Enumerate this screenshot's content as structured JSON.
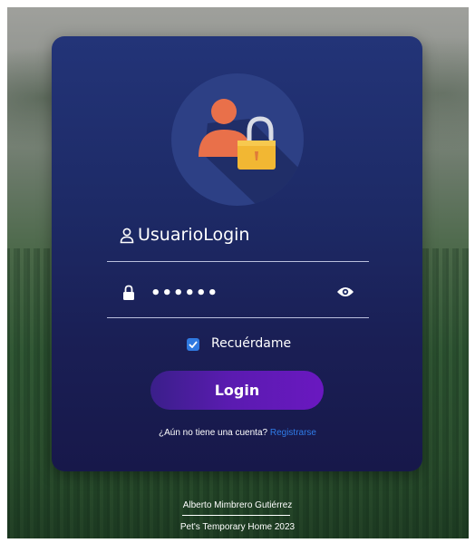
{
  "login": {
    "username_value": "UsuarioLogin",
    "password_masked": "••••••",
    "remember_label": "Recuérdame",
    "remember_checked": true,
    "login_button": "Login",
    "register_prompt": "¿Aún no tiene una cuenta?",
    "register_link": "Registrarse"
  },
  "footer": {
    "author": "Alberto Mimbrero Gutiérrez",
    "copyright": "Pet's Temporary Home 2023"
  },
  "icons": {
    "avatar": "user-lock-icon",
    "user": "user-icon",
    "lock": "lock-icon",
    "show_password": "eye-icon",
    "check": "check-icon"
  },
  "colors": {
    "card_top": "#233478",
    "card_bottom": "#17184a",
    "button_start": "#3a1f8a",
    "button_end": "#6a18c0",
    "link": "#2f7be8",
    "checkbox": "#2f79e0",
    "avatar_person": "#e9704a",
    "avatar_lock": "#f2b733"
  }
}
